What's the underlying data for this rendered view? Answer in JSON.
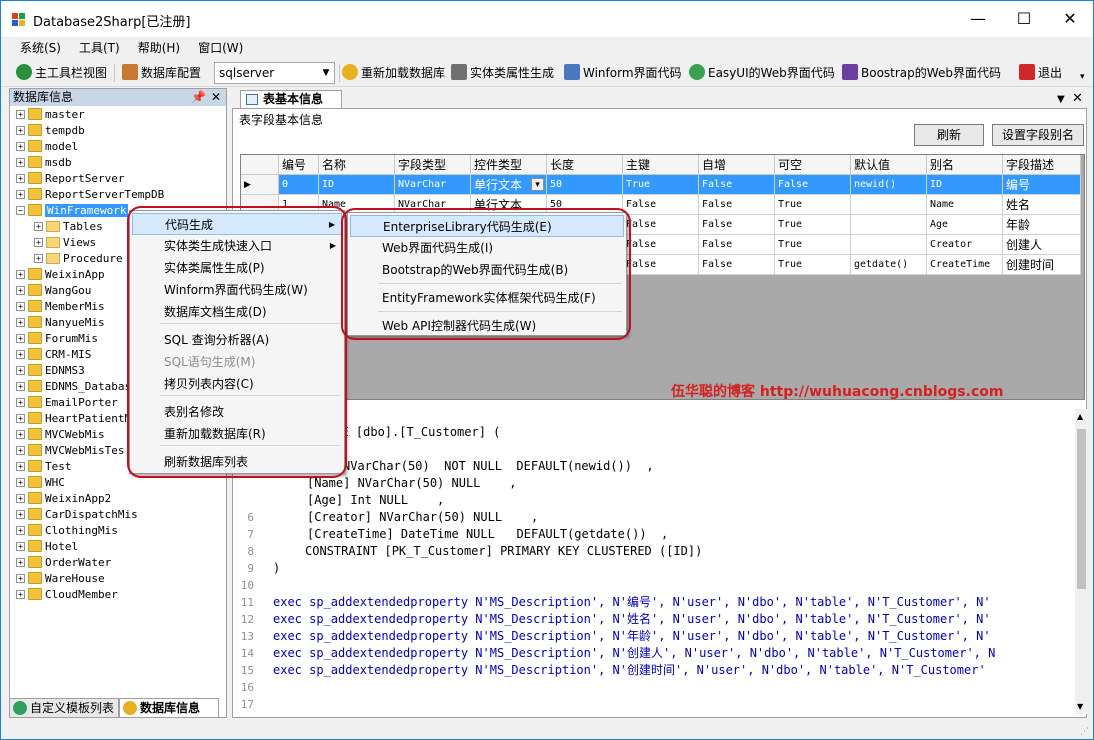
{
  "window": {
    "title": "Database2Sharp[已注册]"
  },
  "menubar": [
    {
      "label": "系统(S)"
    },
    {
      "label": "工具(T)"
    },
    {
      "label": "帮助(H)"
    },
    {
      "label": "窗口(W)"
    }
  ],
  "toolbar": {
    "main_toolbar": "主工具栏视图",
    "db_config": "数据库配置",
    "db_type": "sqlserver",
    "reload_db": "重新加载数据库",
    "entity_gen": "实体类属性生成",
    "winform_code": "Winform界面代码",
    "easyui_code": "EasyUI的Web界面代码",
    "bootstrap_code": "Boostrap的Web界面代码",
    "exit": "退出"
  },
  "left_panel": {
    "title": "数据库信息",
    "databases": [
      "master",
      "tempdb",
      "model",
      "msdb",
      "ReportServer",
      "ReportServerTempDB",
      "WinFramework",
      "WeixinApp",
      "WangGou",
      "MemberMis",
      "NanyueMis",
      "ForumMis",
      "CRM-MIS",
      "EDNMS3",
      "EDNMS_Databas",
      "EmailPorter",
      "HeartPatientM",
      "MVCWebMis",
      "MVCWebMisTes",
      "Test",
      "WHC",
      "WeixinApp2",
      "CarDispatchMis",
      "ClothingMis",
      "Hotel",
      "OrderWater",
      "WareHouse",
      "CloudMember"
    ],
    "children": [
      "Tables",
      "Views",
      "Procedure"
    ],
    "tabs": [
      "自定义模板列表",
      "数据库信息"
    ]
  },
  "doc": {
    "tab": "表基本信息",
    "section_title": "表字段基本信息",
    "refresh": "刷新",
    "set_alias": "设置字段别名",
    "columns": [
      "编号",
      "名称",
      "字段类型",
      "控件类型",
      "长度",
      "主键",
      "自增",
      "可空",
      "默认值",
      "别名",
      "字段描述"
    ],
    "rows": [
      [
        "0",
        "ID",
        "NVarChar",
        "单行文本",
        "50",
        "True",
        "False",
        "False",
        "newid()",
        "ID",
        "编号"
      ],
      [
        "1",
        "Name",
        "NVarChar",
        "单行文本",
        "50",
        "False",
        "False",
        "True",
        "",
        "Name",
        "姓名"
      ],
      [
        "",
        "",
        "",
        "",
        "",
        "False",
        "False",
        "True",
        "",
        "Age",
        "年龄"
      ],
      [
        "",
        "",
        "",
        "",
        "",
        "False",
        "False",
        "True",
        "",
        "Creator",
        "创建人"
      ],
      [
        "",
        "",
        "",
        "",
        "",
        "False",
        "False",
        "True",
        "getdate()",
        "CreateTime",
        "创建时间"
      ]
    ],
    "watermark": "伍华聪的博客  http://wuhuacong.cnblogs.com"
  },
  "code": {
    "line_numbers": [
      "",
      "",
      "",
      "",
      "",
      "",
      "6",
      "7",
      "8",
      "9",
      "10",
      "11",
      "12",
      "13",
      "14",
      "15",
      "16",
      "17"
    ],
    "lines": [
      "表",
      "BLE [dbo].[T_Customer] (",
      "",
      "NVarChar(50)  NOT NULL  DEFAULT(newid())  ,",
      "[Name] NVarChar(50) NULL    ,",
      "[Age] Int NULL    ,",
      "[Creator] NVarChar(50) NULL    ,",
      "[CreateTime] DateTime NULL   DEFAULT(getdate())  ,",
      "CONSTRAINT [PK_T_Customer] PRIMARY KEY CLUSTERED ([ID])",
      ")",
      "",
      "exec sp_addextendedproperty N'MS_Description', N'编号', N'user', N'dbo', N'table', N'T_Customer', N'",
      "exec sp_addextendedproperty N'MS_Description', N'姓名', N'user', N'dbo', N'table', N'T_Customer', N'",
      "exec sp_addextendedproperty N'MS_Description', N'年龄', N'user', N'dbo', N'table', N'T_Customer', N'",
      "exec sp_addextendedproperty N'MS_Description', N'创建人', N'user', N'dbo', N'table', N'T_Customer', N",
      "exec sp_addextendedproperty N'MS_Description', N'创建时间', N'user', N'dbo', N'table', N'T_Customer'"
    ]
  },
  "context_menu": {
    "items": [
      "代码生成",
      "实体类生成快速入口",
      "实体类属性生成(P)",
      "Winform界面代码生成(W)",
      "数据库文档生成(D)",
      "SQL 查询分析器(A)",
      "SQL语句生成(M)",
      "拷贝列表内容(C)",
      "表别名修改",
      "重新加载数据库(R)",
      "刷新数据库列表"
    ],
    "submenu": [
      "EnterpriseLibrary代码生成(E)",
      "Web界面代码生成(I)",
      "Bootstrap的Web界面代码生成(B)",
      "EntityFramework实体框架代码生成(F)",
      "Web API控制器代码生成(W)"
    ]
  }
}
